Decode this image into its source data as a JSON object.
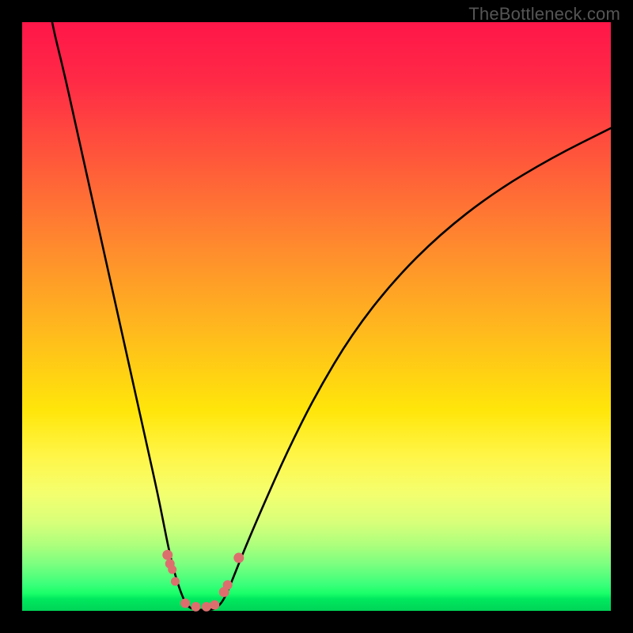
{
  "watermark": "TheBottleneck.com",
  "colors": {
    "frame": "#000000",
    "curve": "#000000",
    "marker": "#dd6e6e",
    "greenBand": "#00d860"
  },
  "chart_data": {
    "type": "line",
    "title": "",
    "xlabel": "",
    "ylabel": "",
    "xlim": [
      0,
      100
    ],
    "ylim": [
      0,
      100
    ],
    "series": [
      {
        "name": "left-branch",
        "x": [
          5,
          7,
          9,
          11,
          13,
          15,
          17,
          19,
          21,
          23,
          24,
          25,
          26,
          27,
          27.8,
          28.5
        ],
        "y": [
          100,
          92,
          83,
          74,
          65,
          56,
          47,
          38,
          29,
          20,
          15,
          10,
          6,
          3,
          1.2,
          0.5
        ]
      },
      {
        "name": "right-branch",
        "x": [
          33,
          34,
          35,
          36,
          38,
          41,
          45,
          50,
          56,
          63,
          71,
          80,
          90,
          100
        ],
        "y": [
          0.5,
          1.5,
          3.5,
          6,
          11,
          18,
          27,
          37,
          47,
          56,
          64,
          71,
          77,
          82
        ]
      }
    ],
    "markers": [
      {
        "x": 24.7,
        "y": 9.5,
        "r": 6.5
      },
      {
        "x": 25.1,
        "y": 8.0,
        "r": 6
      },
      {
        "x": 25.5,
        "y": 7.0,
        "r": 5.5
      },
      {
        "x": 26.0,
        "y": 5.0,
        "r": 5.5
      },
      {
        "x": 27.7,
        "y": 1.3,
        "r": 6
      },
      {
        "x": 29.5,
        "y": 0.7,
        "r": 6
      },
      {
        "x": 31.3,
        "y": 0.7,
        "r": 6
      },
      {
        "x": 32.7,
        "y": 1.0,
        "r": 6
      },
      {
        "x": 34.3,
        "y": 3.2,
        "r": 6.5
      },
      {
        "x": 34.9,
        "y": 4.4,
        "r": 6
      },
      {
        "x": 36.8,
        "y": 9.0,
        "r": 6.5
      }
    ],
    "notes": "Axes unlabelled in source image; x and y expressed as 0–100 percent of plot extent. Curves form a V with vertex near x≈30, y≈0."
  }
}
